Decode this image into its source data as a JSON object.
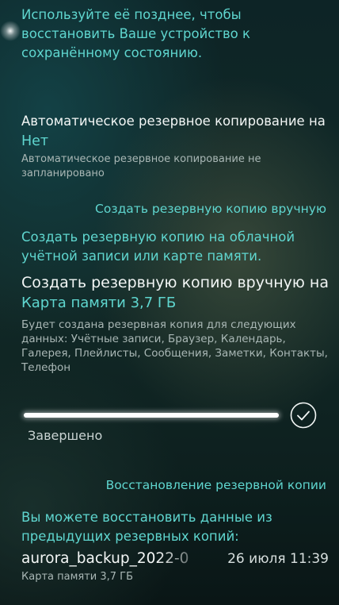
{
  "intro_text": "Используйте её позднее, чтобы восстановить Ваше устройство к сохранённому состоянию.",
  "auto_backup": {
    "title": "Автоматическое резервное копирование на",
    "value": "Нет",
    "description": "Автоматическое резервное копирование не запланировано"
  },
  "manual_section": {
    "header": "Создать резервную копию вручную",
    "cloud_link": "Создать резервную копию на облачной учётной записи или карте памяти.",
    "title": "Создать резервную копию вручную на",
    "value": "Карта памяти 3,7 ГБ",
    "description": "Будет создана резервная копия для следующих данных: Учётные записи, Браузер, Календарь, Галерея, Плейлисты, Сообщения, Заметки, Контакты, Телефон",
    "progress": 1.0,
    "status": "Завершено"
  },
  "restore_section": {
    "header": "Восстановление резервной копии",
    "description": "Вы можете восстановить данные из предыдущих резервных копий:",
    "items": [
      {
        "name": "aurora_backup_2022-0",
        "date": "26 июля 11:39",
        "location": "Карта памяти 3,7 ГБ"
      }
    ]
  },
  "icons": {
    "done": "checkmark-circle-icon"
  },
  "colors": {
    "accent": "#5fd6cf",
    "primary_text": "#f2f6f5",
    "secondary_text": "#a9b7b5"
  }
}
